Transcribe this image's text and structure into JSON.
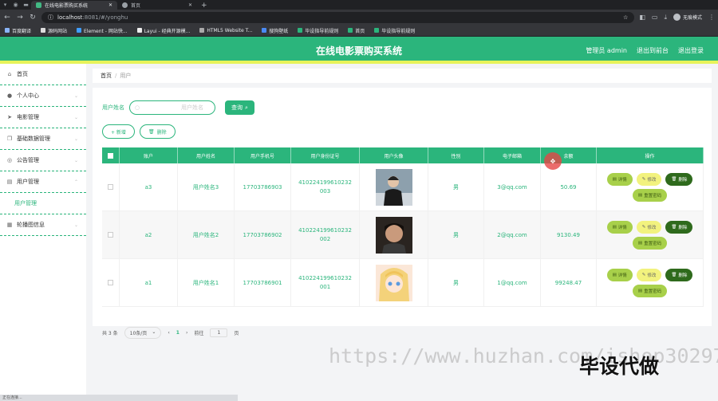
{
  "browser": {
    "tabs": [
      {
        "title": "在线电影票购买系统",
        "active": true
      },
      {
        "title": "首页",
        "active": false
      }
    ],
    "url_host": "localhost",
    "url_rest": ":8081/#/yonghu",
    "profile": "无痕模式",
    "bookmarks": [
      "百度翻译",
      "源码网站",
      "Element - 网站快...",
      "Layui - 经典开源模...",
      "HTML5 Website T...",
      "搜狗壁纸",
      "毕设指导前规则",
      "首页",
      "毕设指导前规则"
    ],
    "status_text": "正在连接..."
  },
  "header": {
    "title": "在线电影票购买系统",
    "links": [
      "管理员 admin",
      "退出到前台",
      "退出登录"
    ]
  },
  "sidebar": {
    "items": [
      {
        "label": "首页",
        "icon": "home-icon",
        "has_children": false
      },
      {
        "label": "个人中心",
        "icon": "user-icon",
        "has_children": true
      },
      {
        "label": "电影管理",
        "icon": "send-icon",
        "has_children": true
      },
      {
        "label": "基础数据管理",
        "icon": "copy-icon",
        "has_children": true
      },
      {
        "label": "公告管理",
        "icon": "location-icon",
        "has_children": true
      },
      {
        "label": "用户管理",
        "icon": "document-icon",
        "has_children": true,
        "expanded": true
      },
      {
        "label": "轮播图信息",
        "icon": "grid-icon",
        "has_children": true
      }
    ],
    "sub_item": "用户管理"
  },
  "breadcrumb": {
    "home": "首页",
    "current": "用户"
  },
  "search": {
    "label": "用户姓名",
    "placeholder": "用户姓名",
    "button": "查询"
  },
  "actions": {
    "add": "+ 新增",
    "delete": "删除"
  },
  "table": {
    "headers": [
      "账户",
      "用户姓名",
      "用户手机号",
      "用户身份证号",
      "用户头像",
      "性别",
      "电子邮箱",
      "余额",
      "操作"
    ],
    "rows": [
      {
        "account": "a3",
        "name": "用户姓名3",
        "phone": "17703786903",
        "id_line1": "410224199610232",
        "id_line2": "003",
        "sex": "男",
        "email": "3@qq.com",
        "balance": "50.69",
        "avatar_color": "#6b7b8c"
      },
      {
        "account": "a2",
        "name": "用户姓名2",
        "phone": "17703786902",
        "id_line1": "410224199610232",
        "id_line2": "002",
        "sex": "男",
        "email": "2@qq.com",
        "balance": "9130.49",
        "avatar_color": "#3b2f2a"
      },
      {
        "account": "a1",
        "name": "用户姓名1",
        "phone": "17703786901",
        "id_line1": "410224199610232",
        "id_line2": "001",
        "sex": "男",
        "email": "1@qq.com",
        "balance": "99248.47",
        "avatar_color": "#f5c9a8"
      }
    ],
    "ops": {
      "detail": "详情",
      "edit": "修改",
      "delete": "删除",
      "reset": "重置密码"
    }
  },
  "pager": {
    "total": "共 3 条",
    "size": "10条/页",
    "prev": "‹",
    "page": "1",
    "next": "›",
    "goto": "前往",
    "goto_val": "1",
    "unit": "页"
  },
  "watermark": {
    "url": "https://www.huzhan.com/ishop30297",
    "brand": "毕设代做"
  },
  "colors": {
    "primary": "#2bb57c",
    "accent_bar": "#e7f35a",
    "cursor": "#e64646"
  }
}
